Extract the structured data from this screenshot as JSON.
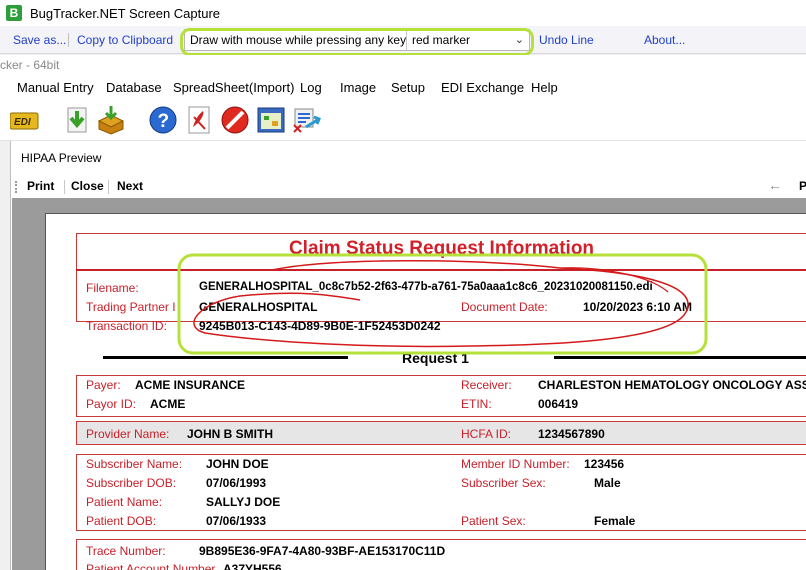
{
  "capture_window": {
    "title": "BugTracker.NET Screen Capture",
    "logo_letter": "B",
    "toolbar": {
      "save_as": "Save as...",
      "copy_clipboard": "Copy to Clipboard",
      "draw_label": "Draw with mouse while pressing any key",
      "marker_selected": "red marker",
      "undo_line": "Undo Line",
      "about": "About..."
    }
  },
  "app": {
    "title_fragment": "cker - 64bit",
    "menu": [
      "Manual Entry",
      "Database",
      "SpreadSheet(Import)",
      "Log",
      "Image",
      "Setup",
      "EDI Exchange",
      "Help"
    ],
    "toolbar_icons": [
      "edi-icon",
      "download-icon",
      "import-icon",
      "help-icon",
      "pdf-icon",
      "stop-icon",
      "calendar-icon",
      "export-icon"
    ]
  },
  "preview": {
    "title": "HIPAA Preview",
    "buttons": {
      "print": "Print",
      "close": "Close",
      "next": "Next"
    },
    "arrow": "←",
    "p_label": "P"
  },
  "document": {
    "heading": "Claim Status Request Information",
    "file_info": {
      "filename_label": "Filename:",
      "filename_value": "GENERALHOSPITAL_0c8c7b52-2f63-477b-a761-75a0aaa1c8c6_20231020081150.edi",
      "trading_partner_label": "Trading Partner I",
      "trading_partner_value": "GENERALHOSPITAL",
      "document_date_label": "Document Date:",
      "document_date_value": "10/20/2023 6:10 AM",
      "transaction_id_label": "Transaction ID:",
      "transaction_id_value": "9245B013-C143-4D89-9B0E-1F52453D0242"
    },
    "request_label": "Request 1",
    "payer": {
      "payer_label": "Payer:",
      "payer_value": "ACME INSURANCE",
      "payor_id_label": "Payor ID:",
      "payor_id_value": "ACME",
      "receiver_label": "Receiver:",
      "receiver_value": "CHARLESTON HEMATOLOGY ONCOLOGY ASS",
      "etin_label": "ETIN:",
      "etin_value": "006419"
    },
    "provider": {
      "provider_label": "Provider Name:",
      "provider_value": "JOHN B  SMITH",
      "hcfa_label": "HCFA ID:",
      "hcfa_value": "1234567890"
    },
    "subscriber": {
      "subscriber_name_label": "Subscriber Name:",
      "subscriber_name_value": "JOHN  DOE",
      "member_id_label": "Member ID Number:",
      "member_id_value": "123456",
      "subscriber_dob_label": "Subscriber DOB:",
      "subscriber_dob_value": "07/06/1993",
      "subscriber_sex_label": "Subscriber Sex:",
      "subscriber_sex_value": "Male",
      "patient_name_label": "Patient Name:",
      "patient_name_value": "SALLYJ  DOE",
      "patient_dob_label": "Patient DOB:",
      "patient_dob_value": "07/06/1933",
      "patient_sex_label": "Patient Sex:",
      "patient_sex_value": "Female"
    },
    "trace": {
      "trace_label": "Trace Number:",
      "trace_value": "9B895E36-9FA7-4A80-93BF-AE153170C11D",
      "patient_account_label": "Patient Account Number",
      "patient_account_value": "A37YH556"
    }
  },
  "colors": {
    "label_red": "#c8202a",
    "highlight_green": "#b6e13a",
    "link_blue": "#1f3fc8"
  }
}
